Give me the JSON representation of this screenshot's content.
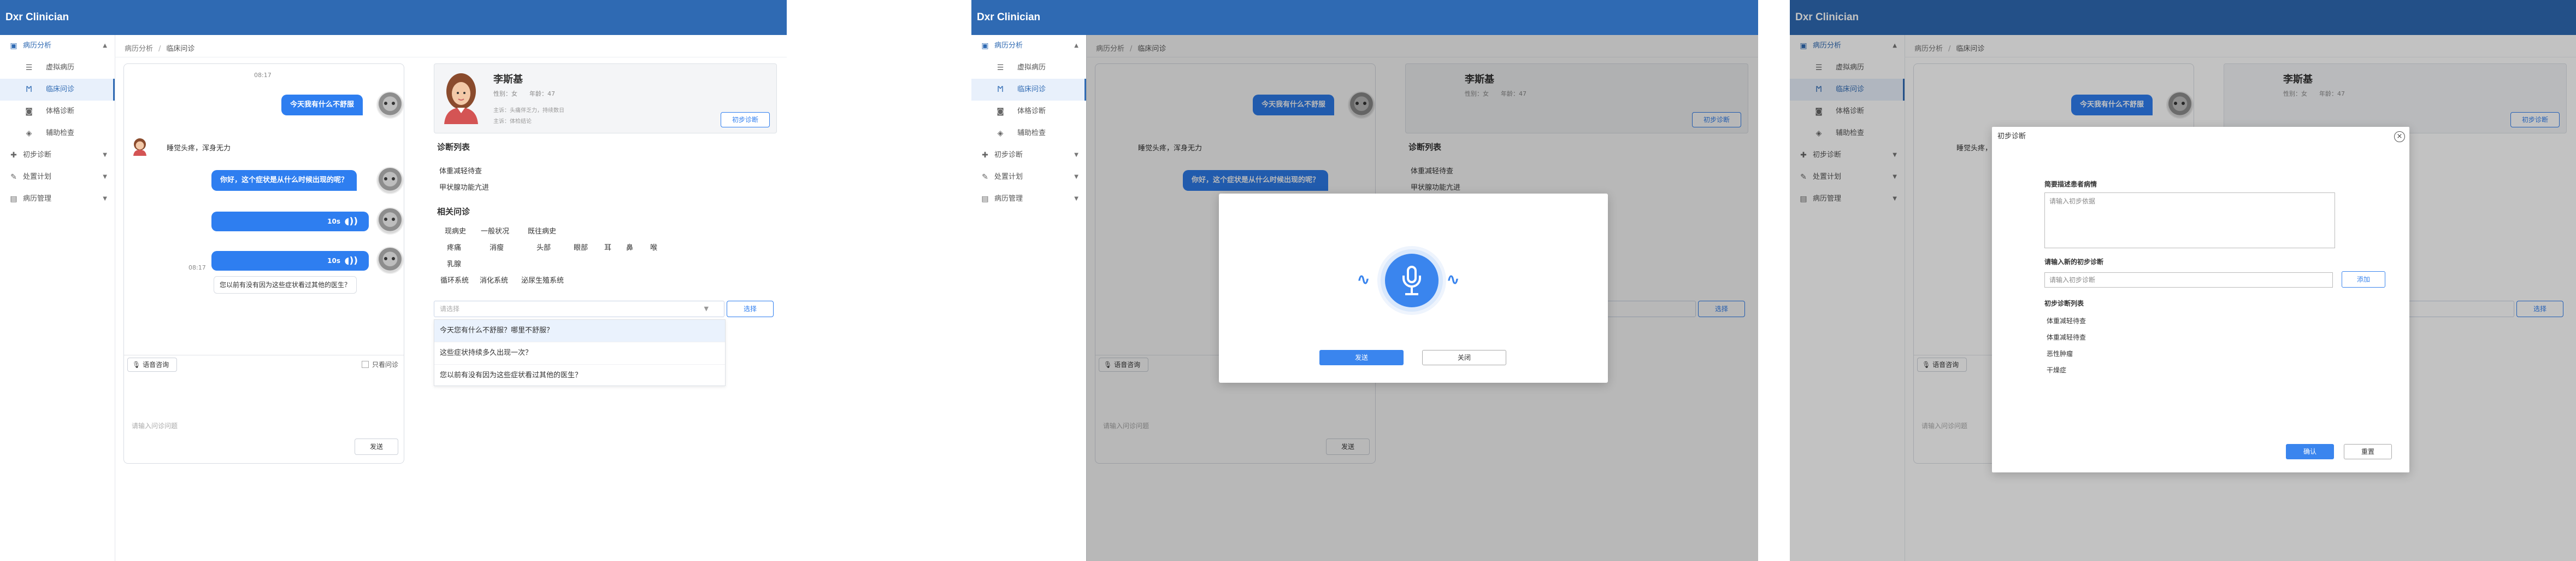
{
  "app": {
    "title": "Dxr Clinician"
  },
  "sidebar": {
    "items": [
      {
        "label": "病历分析",
        "icon": "clipboard-icon"
      },
      {
        "label": "虚拟病历",
        "icon": "document-icon"
      },
      {
        "label": "临床问诊",
        "icon": "stethoscope-icon"
      },
      {
        "label": "体格诊断",
        "icon": "camera-icon"
      },
      {
        "label": "辅助检查",
        "icon": "flask-icon"
      },
      {
        "label": "初步诊断",
        "icon": "diagnosis-icon"
      },
      {
        "label": "处置计划",
        "icon": "plan-icon"
      },
      {
        "label": "病历管理",
        "icon": "folder-icon"
      }
    ]
  },
  "breadcrumb": {
    "root": "病历分析",
    "sep": "/",
    "current": "临床问诊"
  },
  "chat": {
    "timestamps": [
      "08:17",
      "08:17"
    ],
    "messages": {
      "user_1": "今天我有什么不舒服",
      "patient_1": "睡觉头疼，浑身无力",
      "user_2": "你好，这个症状是从什么时候出现的呢？"
    },
    "voice_duration": "10s",
    "suggestion": "您以前有没有因为这些症状看过其他的医生？",
    "voice_button": "语音咨询",
    "only_question": "只看问诊",
    "input_placeholder": "请输入问诊问题",
    "send_label": "发送"
  },
  "patient": {
    "name": "李斯基",
    "meta": "性别：女　　年龄：47",
    "line1": "主诉：头痛伴乏力，持续数日",
    "line2": "主诉：体检结论",
    "diag_button": "初步诊断"
  },
  "diagnosis_list": {
    "title": "诊断列表",
    "items": [
      "体重减轻待查",
      "甲状腺功能亢进"
    ]
  },
  "related": {
    "title": "相关问诊",
    "row1": [
      "现病史",
      "一般状况",
      "既往病史"
    ],
    "row2": [
      "疼痛",
      "消瘦",
      "头部",
      "眼部",
      "耳",
      "鼻",
      "喉"
    ],
    "row3": [
      "乳腺"
    ],
    "row4": [
      "循环系统",
      "消化系统",
      "泌尿生殖系统"
    ]
  },
  "select": {
    "placeholder": "请选择",
    "button": "选择"
  },
  "dropdown": {
    "items": [
      "今天您有什么不舒服？哪里不舒服？",
      "这些症状持续多久出现一次？",
      "您以前有没有因为这些症状看过其他的医生？"
    ]
  },
  "recording_modal": {
    "send": "发送",
    "close": "关闭"
  },
  "diagnosis_modal": {
    "title": "初步诊断",
    "desc_label": "简要描述患者病情",
    "desc_placeholder": "请输入初步依据",
    "input_label": "请输入新的初步诊断",
    "input_placeholder": "请输入初步诊断",
    "add": "添加",
    "list_label": "初步诊断列表",
    "list": [
      "体重减轻待查",
      "体重减轻待查",
      "恶性肿瘤",
      "干燥症"
    ],
    "confirm": "确认",
    "cancel": "重置"
  },
  "colors": {
    "brand": "#2f6ab3",
    "accent": "#2e7ef0"
  }
}
